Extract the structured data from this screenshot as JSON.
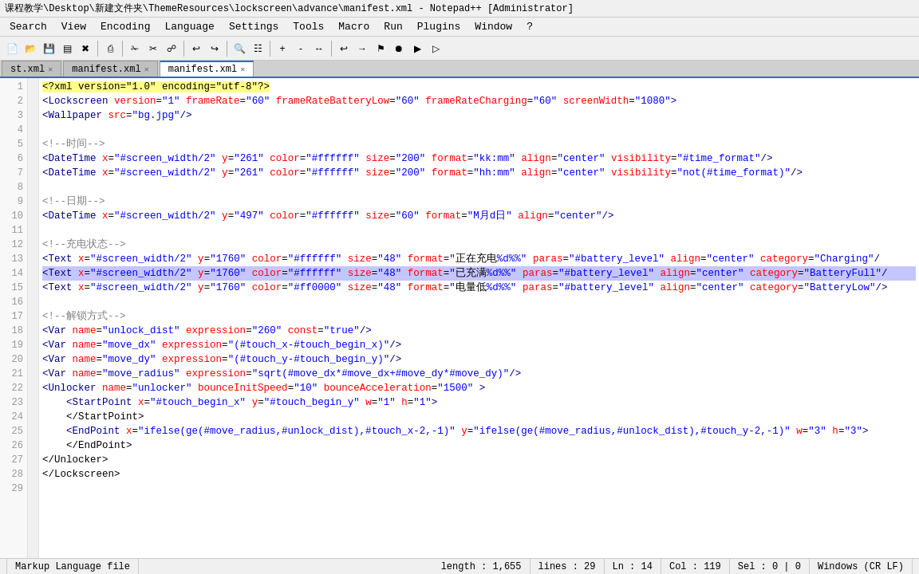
{
  "titlebar": {
    "text": "课程教学\\Desktop\\新建文件夹\\ThemeResources\\lockscreen\\advance\\manifest.xml - Notepad++ [Administrator]"
  },
  "menubar": {
    "items": [
      "Search",
      "View",
      "Encoding",
      "Language",
      "Settings",
      "Tools",
      "Macro",
      "Run",
      "Plugins",
      "Window",
      "?"
    ]
  },
  "tabs": [
    {
      "label": "st.xml",
      "active": false,
      "closeable": true
    },
    {
      "label": "manifest.xml",
      "active": false,
      "closeable": true
    },
    {
      "label": "manifest.xml",
      "active": true,
      "closeable": true
    }
  ],
  "statusbar": {
    "file_type": "Markup Language file",
    "length": "length : 1,655",
    "lines": "lines : 29",
    "ln": "Ln : 14",
    "col": "Col : 119",
    "sel": "Sel : 0 | 0",
    "encoding": "Windows (CR LF)"
  },
  "code": {
    "lines": 29
  }
}
